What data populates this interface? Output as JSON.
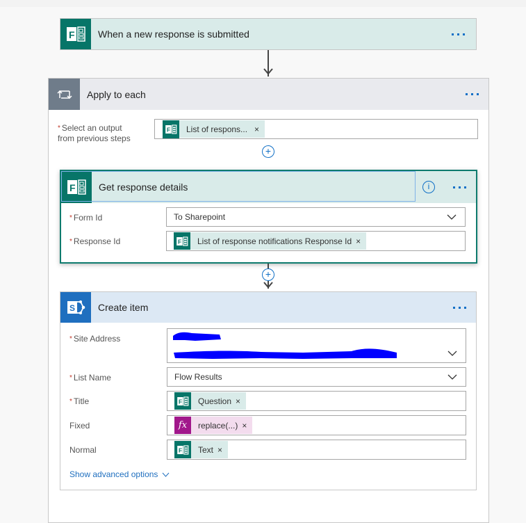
{
  "trigger": {
    "title": "When a new response is submitted",
    "icon": "microsoft-forms-icon",
    "more_label": "More options"
  },
  "apply_to_each": {
    "title": "Apply to each",
    "icon": "loop-icon",
    "select_output": {
      "label_line1": "Select an output",
      "label_line2": "from previous steps",
      "required": "*",
      "token": {
        "label": "List of respons...",
        "icon": "microsoft-forms-icon",
        "remove": "×"
      }
    },
    "add_step": "+"
  },
  "get_response_details": {
    "title": "Get response details",
    "icon": "microsoft-forms-icon",
    "info": "i",
    "fields": [
      {
        "label": "Form Id",
        "required": "*",
        "value": "To Sharepoint",
        "type": "dropdown"
      },
      {
        "label": "Response Id",
        "required": "*",
        "type": "token",
        "token": {
          "label": "List of response notifications Response Id",
          "icon": "microsoft-forms-icon",
          "remove": "×"
        }
      }
    ]
  },
  "between_add": "+",
  "create_item": {
    "title": "Create item",
    "icon": "sharepoint-icon",
    "fields": [
      {
        "label": "Site Address",
        "required": "*",
        "value": "[redacted]",
        "type": "dropdown"
      },
      {
        "label": "List Name",
        "required": "*",
        "value": "Flow Results",
        "type": "dropdown"
      },
      {
        "label": "Title",
        "required": "*",
        "type": "token",
        "token": {
          "label": "Question",
          "icon": "microsoft-forms-icon",
          "remove": "×"
        }
      },
      {
        "label": "Fixed",
        "required": "",
        "type": "token",
        "token": {
          "label": "replace(...)",
          "icon": "fx",
          "remove": "×"
        }
      },
      {
        "label": "Normal",
        "required": "",
        "type": "token",
        "token": {
          "label": "Text",
          "icon": "microsoft-forms-icon",
          "remove": "×"
        }
      }
    ],
    "advanced_link": "Show advanced options"
  },
  "colors": {
    "forms_green": "#077568",
    "sharepoint_blue": "#1f6fbf",
    "loop_gray": "#6f7c8a",
    "accent_blue": "#0f6fc6",
    "fx_purple": "#a1178b",
    "required_red": "#c0392b"
  }
}
